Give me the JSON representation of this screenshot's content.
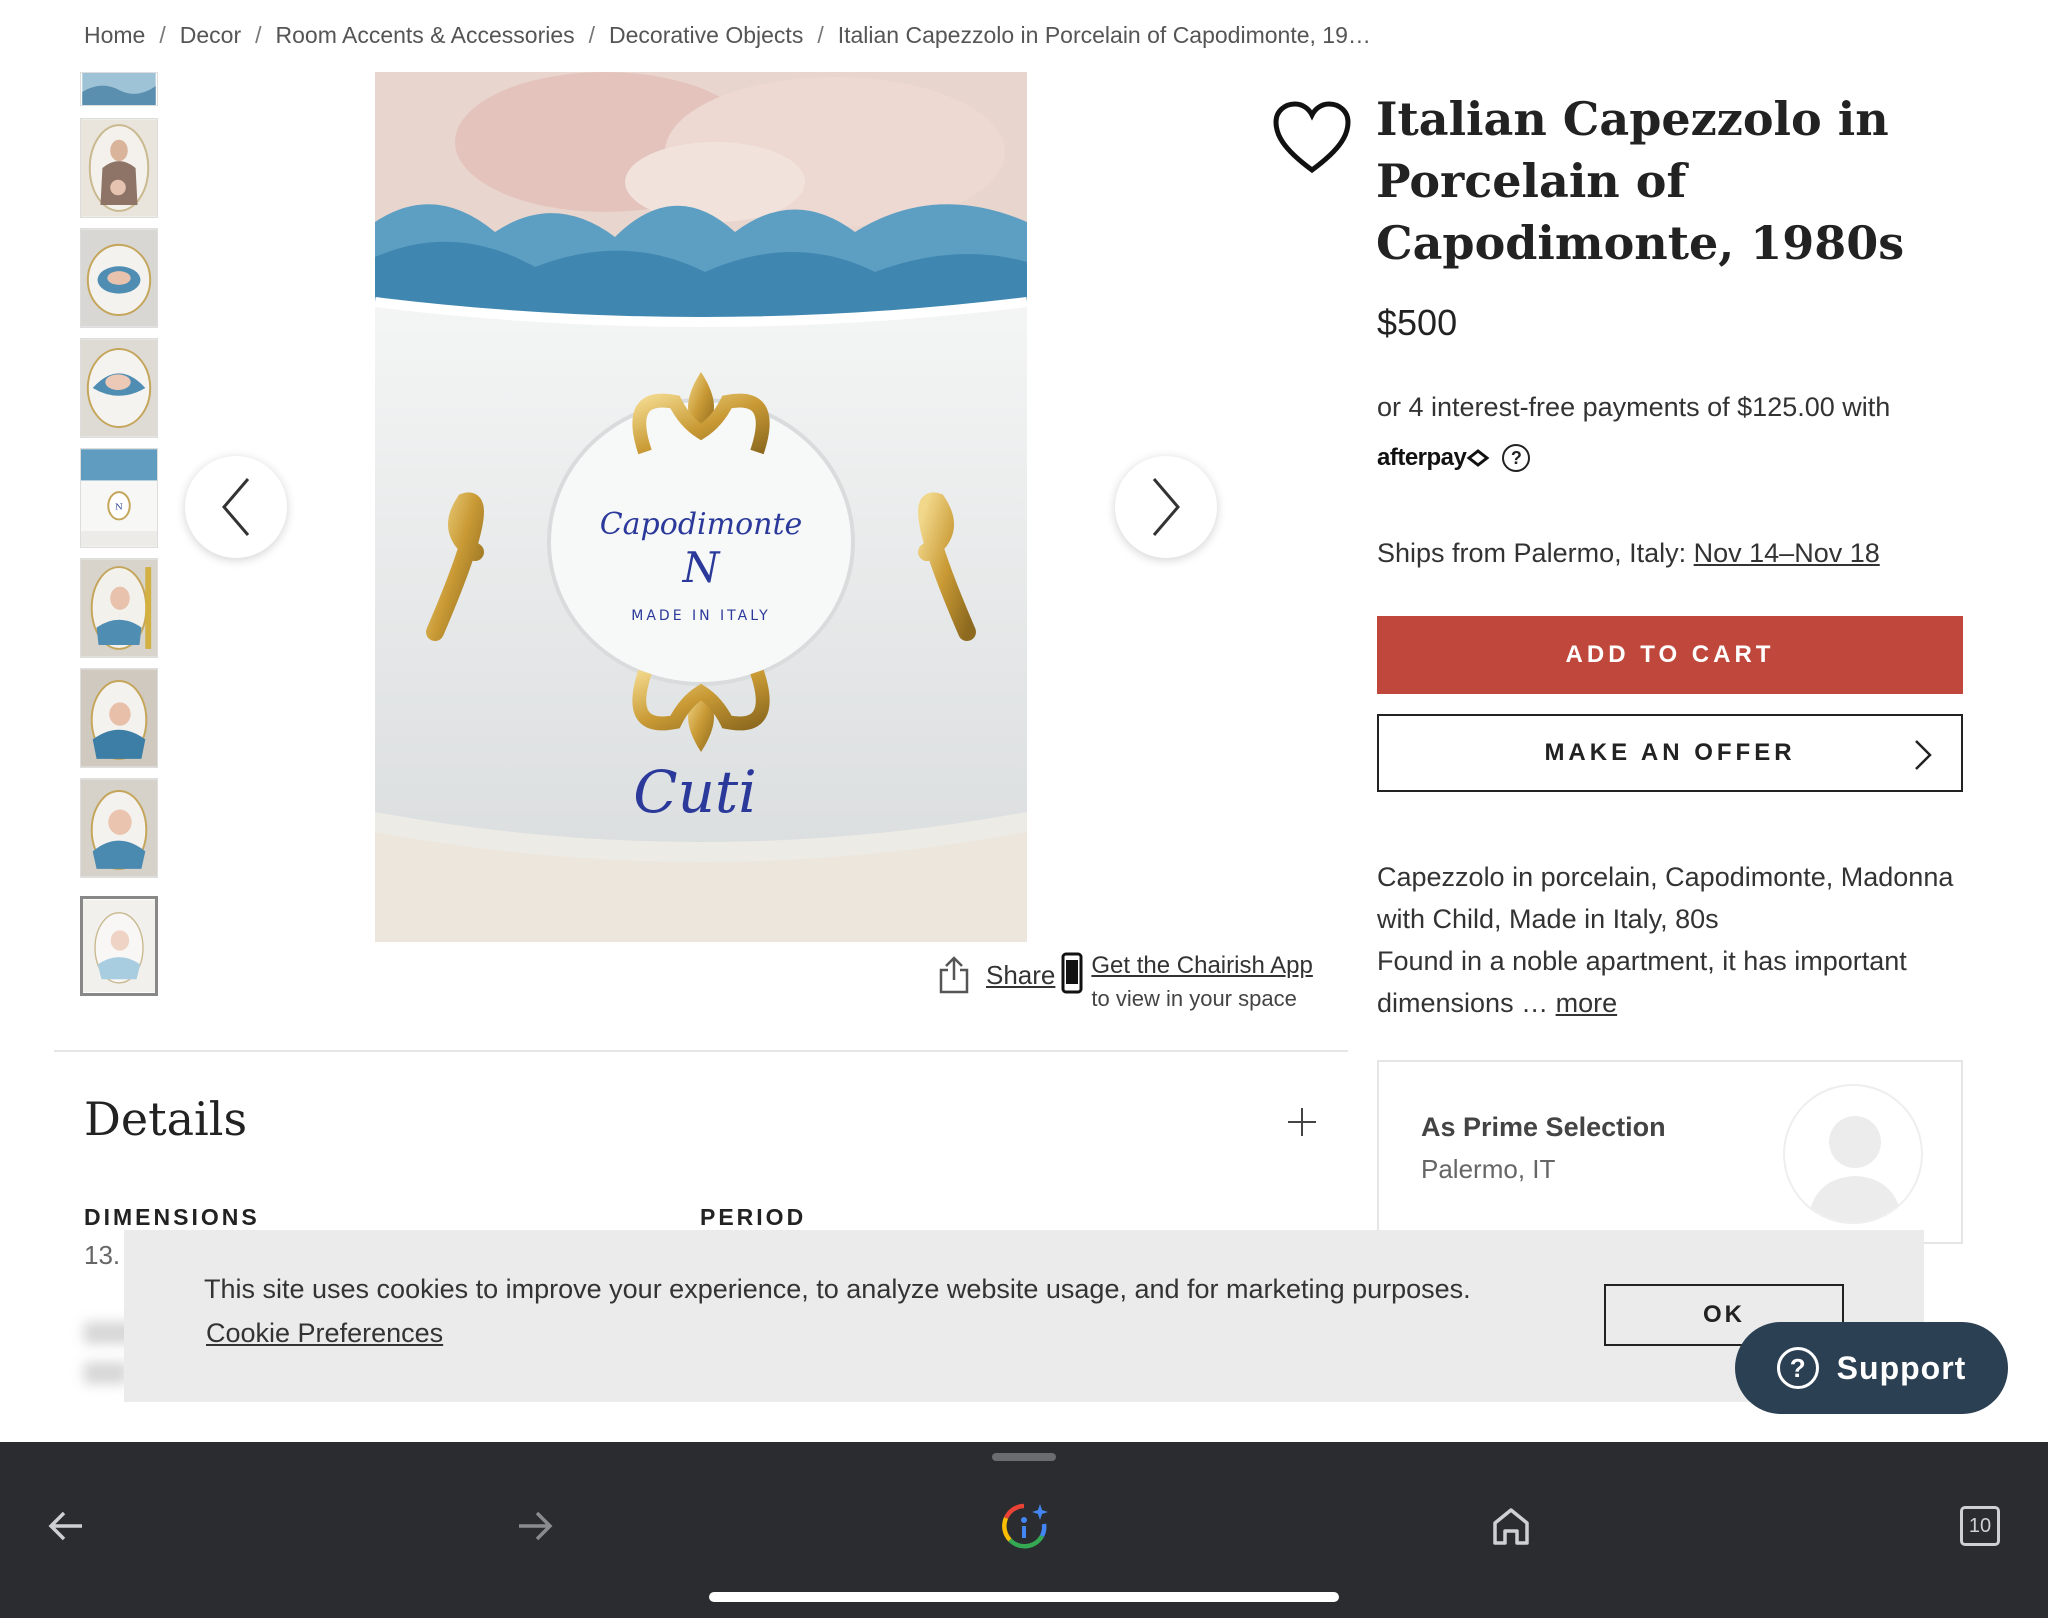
{
  "breadcrumb": {
    "items": [
      "Home",
      "Decor",
      "Room Accents & Accessories",
      "Decorative Objects",
      "Italian Capezzolo in Porcelain of Capodimonte, 19…"
    ],
    "separator": "/"
  },
  "gallery": {
    "thumbnail_count": 9,
    "selected_index": 8,
    "prev_icon": "chevron-left-icon",
    "next_icon": "chevron-right-icon"
  },
  "share": {
    "label": "Share",
    "app_link": "Get the Chairish App",
    "app_sub": "to view in your space"
  },
  "product": {
    "title": "Italian Capezzolo in Porcelain of Capodimonte, 1980s",
    "price": "$500",
    "installments": "or 4 interest-free payments of $125.00 with",
    "afterpay": "afterpay",
    "ships_prefix": "Ships from Palermo, Italy:",
    "ship_dates": "Nov 14–Nov 18",
    "add_to_cart": "ADD TO CART",
    "make_offer": "MAKE AN OFFER",
    "description_line1": "Capezzolo in porcelain, Capodimonte, Madonna with Child, Made in Italy, 80s",
    "description_line2": "Found in a noble apartment, it has important dimensions …",
    "more_link": "more"
  },
  "seller": {
    "name": "As Prime Selection",
    "location": "Palermo, IT"
  },
  "details": {
    "title": "Details",
    "dimensions_label": "DIMENSIONS",
    "dimensions_value": "13.",
    "period_label": "PERIOD"
  },
  "cookie": {
    "text": "This site uses cookies to improve your experience, to analyze website usage, and for marketing purposes.",
    "preferences": "Cookie Preferences",
    "ok": "OK"
  },
  "support": {
    "label": "Support",
    "icon": "?"
  },
  "browser_bar": {
    "tab_count": "10"
  },
  "colors": {
    "accent": "#c0473b",
    "support_bg": "#2c4054",
    "bottom_bar": "#2b2c2f",
    "cookie_bg": "#ebebeb"
  }
}
